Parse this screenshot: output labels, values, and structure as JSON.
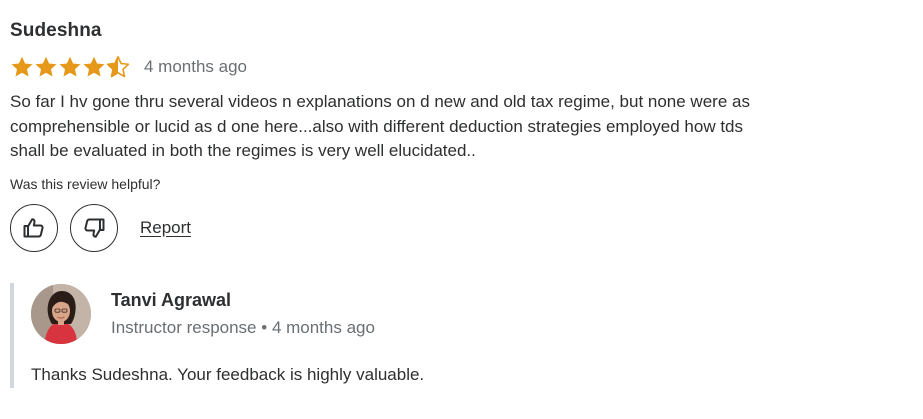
{
  "review": {
    "reviewer_name": "Sudeshna",
    "rating": 4.5,
    "rating_max": 5,
    "date": "4 months ago",
    "body": "So far I hv gone thru several videos n explanations on d new and old tax regime, but none were as comprehensible or lucid as d one here...also with different deduction strategies employed how tds shall be evaluated in both the regimes is very well elucidated..",
    "helpful_prompt": "Was this review helpful?",
    "report_label": "Report"
  },
  "response": {
    "responder_name": "Tanvi Agrawal",
    "role_label": "Instructor response",
    "separator": "•",
    "date": "4 months ago",
    "text": "Thanks Sudeshna. Your feedback is highly valuable."
  },
  "icons": {
    "star": "star-icon",
    "half_star": "star-half-icon",
    "thumbs_up": "thumbs-up-icon",
    "thumbs_down": "thumbs-down-icon"
  },
  "colors": {
    "star": "#e59819",
    "text": "#2d2f31",
    "muted_text": "#6a6f73",
    "response_border": "#d1d7dc"
  }
}
